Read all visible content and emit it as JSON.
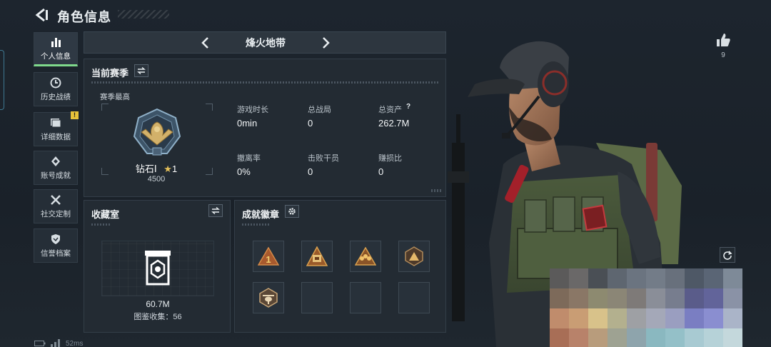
{
  "header": {
    "title": "角色信息"
  },
  "sidebar": {
    "items": [
      {
        "label": "个人信息",
        "active": true,
        "icon": "bar-chart-icon"
      },
      {
        "label": "历史战绩",
        "active": false,
        "icon": "clock-icon"
      },
      {
        "label": "详细数据",
        "active": false,
        "icon": "document-icon",
        "badge": "!"
      },
      {
        "label": "账号成就",
        "active": false,
        "icon": "achievement-icon"
      },
      {
        "label": "社交定制",
        "active": false,
        "icon": "tools-icon"
      },
      {
        "label": "信誉档案",
        "active": false,
        "icon": "shield-icon"
      }
    ]
  },
  "map": {
    "name": "烽火地带"
  },
  "season": {
    "title": "当前赛季",
    "best_label": "赛季最高",
    "rank": {
      "name": "钻石Ⅰ",
      "stars": "1",
      "score": "4500"
    },
    "stats": [
      {
        "label": "游戏时长",
        "value": "0min"
      },
      {
        "label": "总战局",
        "value": "0"
      },
      {
        "label": "总资产",
        "value": "262.7M",
        "help": "?"
      },
      {
        "label": "撤离率",
        "value": "0%"
      },
      {
        "label": "击败干员",
        "value": "0"
      },
      {
        "label": "赚损比",
        "value": "0"
      }
    ]
  },
  "collection": {
    "title": "收藏室",
    "value": "60.7M",
    "catalog_label": "图鉴收集：56"
  },
  "achievements": {
    "title": "成就徽章",
    "badges": [
      "rank-1-badge-icon",
      "vault-badge-icon",
      "squad-badge-icon",
      "triangle-badge-icon",
      "helicopter-badge-icon",
      "empty",
      "empty",
      "empty"
    ]
  },
  "likes": {
    "count": "9"
  },
  "status": {
    "ping": "52ms"
  },
  "colors": {
    "accent_green": "#7fd98c",
    "warning_yellow": "#e8c23a",
    "background": "#1d252e"
  }
}
